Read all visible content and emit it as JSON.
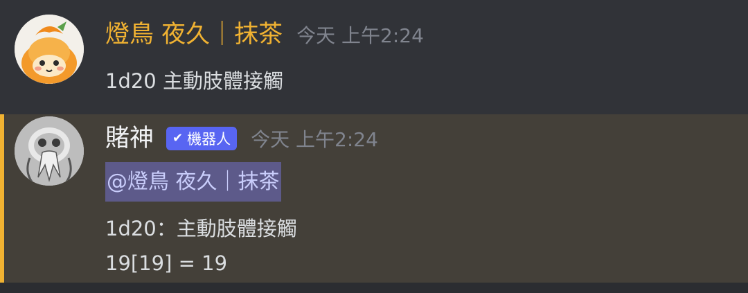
{
  "messages": [
    {
      "username": "燈鳥 夜久｜抹茶",
      "timestamp": "今天 上午2:24",
      "avatar_icon": "orange-creature-avatar",
      "username_color": "#f0b232",
      "lines": [
        "1d20 主動肢體接觸"
      ]
    },
    {
      "username": "賭神",
      "badge": {
        "icon": "checkmark",
        "label": "機器人"
      },
      "timestamp": "今天 上午2:24",
      "avatar_icon": "stone-statue-avatar",
      "mention": "@燈鳥 夜久｜抹茶",
      "lines": [
        "1d20：主動肢體接觸",
        "19[19] = 19"
      ],
      "highlight_color": "#f0b232"
    }
  ],
  "colors": {
    "background": "#313338",
    "mention_background": "#444039",
    "mention_bar": "#f0b232",
    "bot_tag": "#5865f2",
    "mention_pill": "#5d5a8a"
  }
}
